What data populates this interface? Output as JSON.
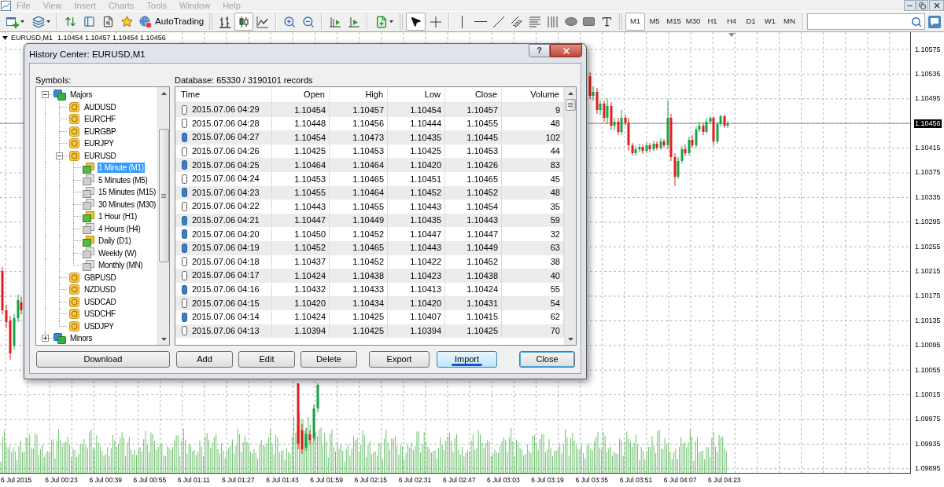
{
  "menu_bar": {
    "items": [
      {
        "label": "File",
        "disabled": true
      },
      {
        "label": "View",
        "disabled": true
      },
      {
        "label": "Insert",
        "disabled": true
      },
      {
        "label": "Charts",
        "disabled": true
      },
      {
        "label": "Tools",
        "disabled": true
      },
      {
        "label": "Window",
        "disabled": true
      },
      {
        "label": "Help",
        "disabled": true
      }
    ]
  },
  "toolbar": {
    "autotrading": {
      "label": "AutoTrading"
    },
    "chart_types": [
      {
        "kind": "bars",
        "selected": false
      },
      {
        "kind": "candles",
        "selected": true
      },
      {
        "kind": "line",
        "selected": false
      }
    ],
    "cursor_tools": [
      {
        "kind": "cursor",
        "selected": true
      },
      {
        "kind": "crosshair",
        "selected": false
      }
    ],
    "timeframes": [
      {
        "label": "M1",
        "selected": true
      },
      {
        "label": "M5",
        "selected": false
      },
      {
        "label": "M15",
        "selected": false
      },
      {
        "label": "M30",
        "selected": false
      },
      {
        "label": "H1",
        "selected": false
      },
      {
        "label": "H4",
        "selected": false
      },
      {
        "label": "D1",
        "selected": false
      },
      {
        "label": "W1",
        "selected": false
      },
      {
        "label": "MN",
        "selected": false
      }
    ]
  },
  "chart": {
    "header": {
      "symbol": "EURUSD,M1",
      "ohlc": "1.10454 1.10457 1.10454 1.10456"
    },
    "price_labels": [
      {
        "text": "1.10575",
        "current": false
      },
      {
        "text": "1.10535",
        "current": false
      },
      {
        "text": "1.10495",
        "current": false
      },
      {
        "text": "1.10456",
        "current": true
      },
      {
        "text": "1.10415",
        "current": false
      },
      {
        "text": "1.10375",
        "current": false
      },
      {
        "text": "1.10335",
        "current": false
      },
      {
        "text": "1.10295",
        "current": false
      },
      {
        "text": "1.10255",
        "current": false
      },
      {
        "text": "1.10215",
        "current": false
      },
      {
        "text": "1.10175",
        "current": false
      },
      {
        "text": "1.10135",
        "current": false
      },
      {
        "text": "1.10095",
        "current": false
      },
      {
        "text": "1.10055",
        "current": false
      },
      {
        "text": "1.10015",
        "current": false
      },
      {
        "text": "1.09975",
        "current": false
      },
      {
        "text": "1.09935",
        "current": false
      },
      {
        "text": "1.09895",
        "current": false
      }
    ],
    "time_labels": [
      "6 Jul 2015",
      "6 Jul 00:23",
      "6 Jul 00:39",
      "6 Jul 00:55",
      "6 Jul 01:11",
      "6 Jul 01:27",
      "6 Jul 01:43",
      "6 Jul 01:59",
      "6 Jul 02:15",
      "6 Jul 02:31",
      "6 Jul 02:47",
      "6 Jul 03:03",
      "6 Jul 03:19",
      "6 Jul 03:35",
      "6 Jul 03:51",
      "6 Jul 04:07",
      "6 Jul 04:23"
    ]
  },
  "dialog": {
    "title": "History Center: EURUSD,M1",
    "help_label": "?",
    "symbols_label": "Symbols:",
    "tree": [
      {
        "label": "Majors",
        "kind": "group",
        "expanded": true,
        "selected": false,
        "children": [
          {
            "label": "AUDUSD",
            "kind": "symbol",
            "selected": false
          },
          {
            "label": "EURCHF",
            "kind": "symbol",
            "selected": false
          },
          {
            "label": "EURGBP",
            "kind": "symbol",
            "selected": false
          },
          {
            "label": "EURJPY",
            "kind": "symbol",
            "selected": false
          },
          {
            "label": "EURUSD",
            "kind": "symbol",
            "expanded": true,
            "selected": false,
            "children": [
              {
                "label": "1 Minute (M1)",
                "kind": "timeframe",
                "has_data": true,
                "selected": true
              },
              {
                "label": "5 Minutes (M5)",
                "kind": "timeframe",
                "has_data": false,
                "selected": false
              },
              {
                "label": "15 Minutes (M15)",
                "kind": "timeframe",
                "has_data": false,
                "selected": false
              },
              {
                "label": "30 Minutes (M30)",
                "kind": "timeframe",
                "has_data": false,
                "selected": false
              },
              {
                "label": "1 Hour (H1)",
                "kind": "timeframe",
                "has_data": true,
                "selected": false
              },
              {
                "label": "4 Hours (H4)",
                "kind": "timeframe",
                "has_data": false,
                "selected": false
              },
              {
                "label": "Daily (D1)",
                "kind": "timeframe",
                "has_data": true,
                "selected": false
              },
              {
                "label": "Weekly (W)",
                "kind": "timeframe",
                "has_data": false,
                "selected": false
              },
              {
                "label": "Monthly (MN)",
                "kind": "timeframe",
                "has_data": false,
                "selected": false
              }
            ]
          },
          {
            "label": "GBPUSD",
            "kind": "symbol",
            "selected": false
          },
          {
            "label": "NZDUSD",
            "kind": "symbol",
            "selected": false
          },
          {
            "label": "USDCAD",
            "kind": "symbol",
            "selected": false
          },
          {
            "label": "USDCHF",
            "kind": "symbol",
            "selected": false
          },
          {
            "label": "USDJPY",
            "kind": "symbol",
            "selected": false
          }
        ]
      },
      {
        "label": "Minors",
        "kind": "group",
        "expanded": false,
        "selected": false
      }
    ],
    "database_label": "Database: 65330 / 3190101 records",
    "table": {
      "columns": [
        "Time",
        "Open",
        "High",
        "Low",
        "Close",
        "Volume"
      ],
      "rows": [
        {
          "filled": false,
          "cells": [
            "2015.07.06 04:29",
            "1.10454",
            "1.10457",
            "1.10454",
            "1.10457",
            "9"
          ]
        },
        {
          "filled": false,
          "cells": [
            "2015.07.06 04:28",
            "1.10448",
            "1.10456",
            "1.10444",
            "1.10455",
            "48"
          ]
        },
        {
          "filled": true,
          "cells": [
            "2015.07.06 04:27",
            "1.10454",
            "1.10473",
            "1.10435",
            "1.10445",
            "102"
          ]
        },
        {
          "filled": false,
          "cells": [
            "2015.07.06 04:26",
            "1.10425",
            "1.10453",
            "1.10425",
            "1.10453",
            "44"
          ]
        },
        {
          "filled": true,
          "cells": [
            "2015.07.06 04:25",
            "1.10464",
            "1.10464",
            "1.10420",
            "1.10426",
            "83"
          ]
        },
        {
          "filled": false,
          "cells": [
            "2015.07.06 04:24",
            "1.10453",
            "1.10465",
            "1.10451",
            "1.10465",
            "45"
          ]
        },
        {
          "filled": true,
          "cells": [
            "2015.07.06 04:23",
            "1.10455",
            "1.10464",
            "1.10452",
            "1.10452",
            "48"
          ]
        },
        {
          "filled": false,
          "cells": [
            "2015.07.06 04:22",
            "1.10443",
            "1.10455",
            "1.10443",
            "1.10454",
            "35"
          ]
        },
        {
          "filled": true,
          "cells": [
            "2015.07.06 04:21",
            "1.10447",
            "1.10449",
            "1.10435",
            "1.10443",
            "59"
          ]
        },
        {
          "filled": true,
          "cells": [
            "2015.07.06 04:20",
            "1.10450",
            "1.10452",
            "1.10447",
            "1.10447",
            "32"
          ]
        },
        {
          "filled": true,
          "cells": [
            "2015.07.06 04:19",
            "1.10452",
            "1.10465",
            "1.10443",
            "1.10449",
            "63"
          ]
        },
        {
          "filled": false,
          "cells": [
            "2015.07.06 04:18",
            "1.10437",
            "1.10452",
            "1.10422",
            "1.10452",
            "38"
          ]
        },
        {
          "filled": false,
          "cells": [
            "2015.07.06 04:17",
            "1.10424",
            "1.10438",
            "1.10423",
            "1.10438",
            "40"
          ]
        },
        {
          "filled": true,
          "cells": [
            "2015.07.06 04:16",
            "1.10432",
            "1.10433",
            "1.10413",
            "1.10424",
            "55"
          ]
        },
        {
          "filled": false,
          "cells": [
            "2015.07.06 04:15",
            "1.10420",
            "1.10434",
            "1.10420",
            "1.10431",
            "54"
          ]
        },
        {
          "filled": true,
          "cells": [
            "2015.07.06 04:14",
            "1.10424",
            "1.10425",
            "1.10407",
            "1.10415",
            "62"
          ]
        },
        {
          "filled": false,
          "cells": [
            "2015.07.06 04:13",
            "1.10394",
            "1.10425",
            "1.10394",
            "1.10425",
            "70"
          ]
        }
      ]
    },
    "buttons": [
      {
        "label": "Download",
        "hovered": false,
        "default": false,
        "marked": false
      },
      {
        "label": "Add",
        "hovered": false,
        "default": false,
        "marked": false
      },
      {
        "label": "Edit",
        "hovered": false,
        "default": false,
        "marked": false
      },
      {
        "label": "Delete",
        "hovered": false,
        "default": false,
        "marked": false
      },
      {
        "label": "Export",
        "hovered": false,
        "default": false,
        "marked": false
      },
      {
        "label": "Import",
        "hovered": true,
        "default": false,
        "marked": true
      },
      {
        "label": "Close",
        "hovered": false,
        "default": true,
        "marked": false
      }
    ]
  }
}
